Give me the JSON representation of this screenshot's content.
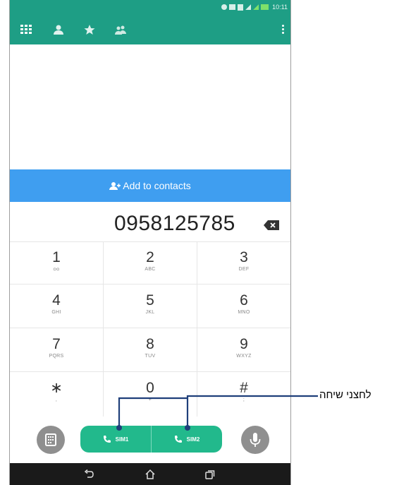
{
  "status_bar": {
    "time": "10:11"
  },
  "app_bar": {
    "icons": [
      "dialpad-icon",
      "contacts-icon",
      "favorites-icon",
      "groups-icon"
    ],
    "menu_icon": "overflow-menu-icon"
  },
  "add_contacts": {
    "label": "Add to contacts",
    "icon": "add-contact-icon"
  },
  "dial": {
    "number": "0958125785"
  },
  "keypad": [
    {
      "digit": "1",
      "letters": "ᴑᴑ"
    },
    {
      "digit": "2",
      "letters": "ABC"
    },
    {
      "digit": "3",
      "letters": "DEF"
    },
    {
      "digit": "4",
      "letters": "GHI"
    },
    {
      "digit": "5",
      "letters": "JKL"
    },
    {
      "digit": "6",
      "letters": "MNO"
    },
    {
      "digit": "7",
      "letters": "PQRS"
    },
    {
      "digit": "8",
      "letters": "TUV"
    },
    {
      "digit": "9",
      "letters": "WXYZ"
    },
    {
      "digit": "∗",
      "letters": ","
    },
    {
      "digit": "0",
      "letters": "+"
    },
    {
      "digit": "#",
      "letters": ";"
    }
  ],
  "call_buttons": {
    "sim1_label": "SIM1",
    "sim2_label": "SIM2"
  },
  "annotation": {
    "label": "לחצני שיחה"
  },
  "colors": {
    "appbar": "#1e9e85",
    "add_bar": "#3f9ef0",
    "call_green": "#22b98c",
    "nav_bar": "#1a1a1a"
  }
}
